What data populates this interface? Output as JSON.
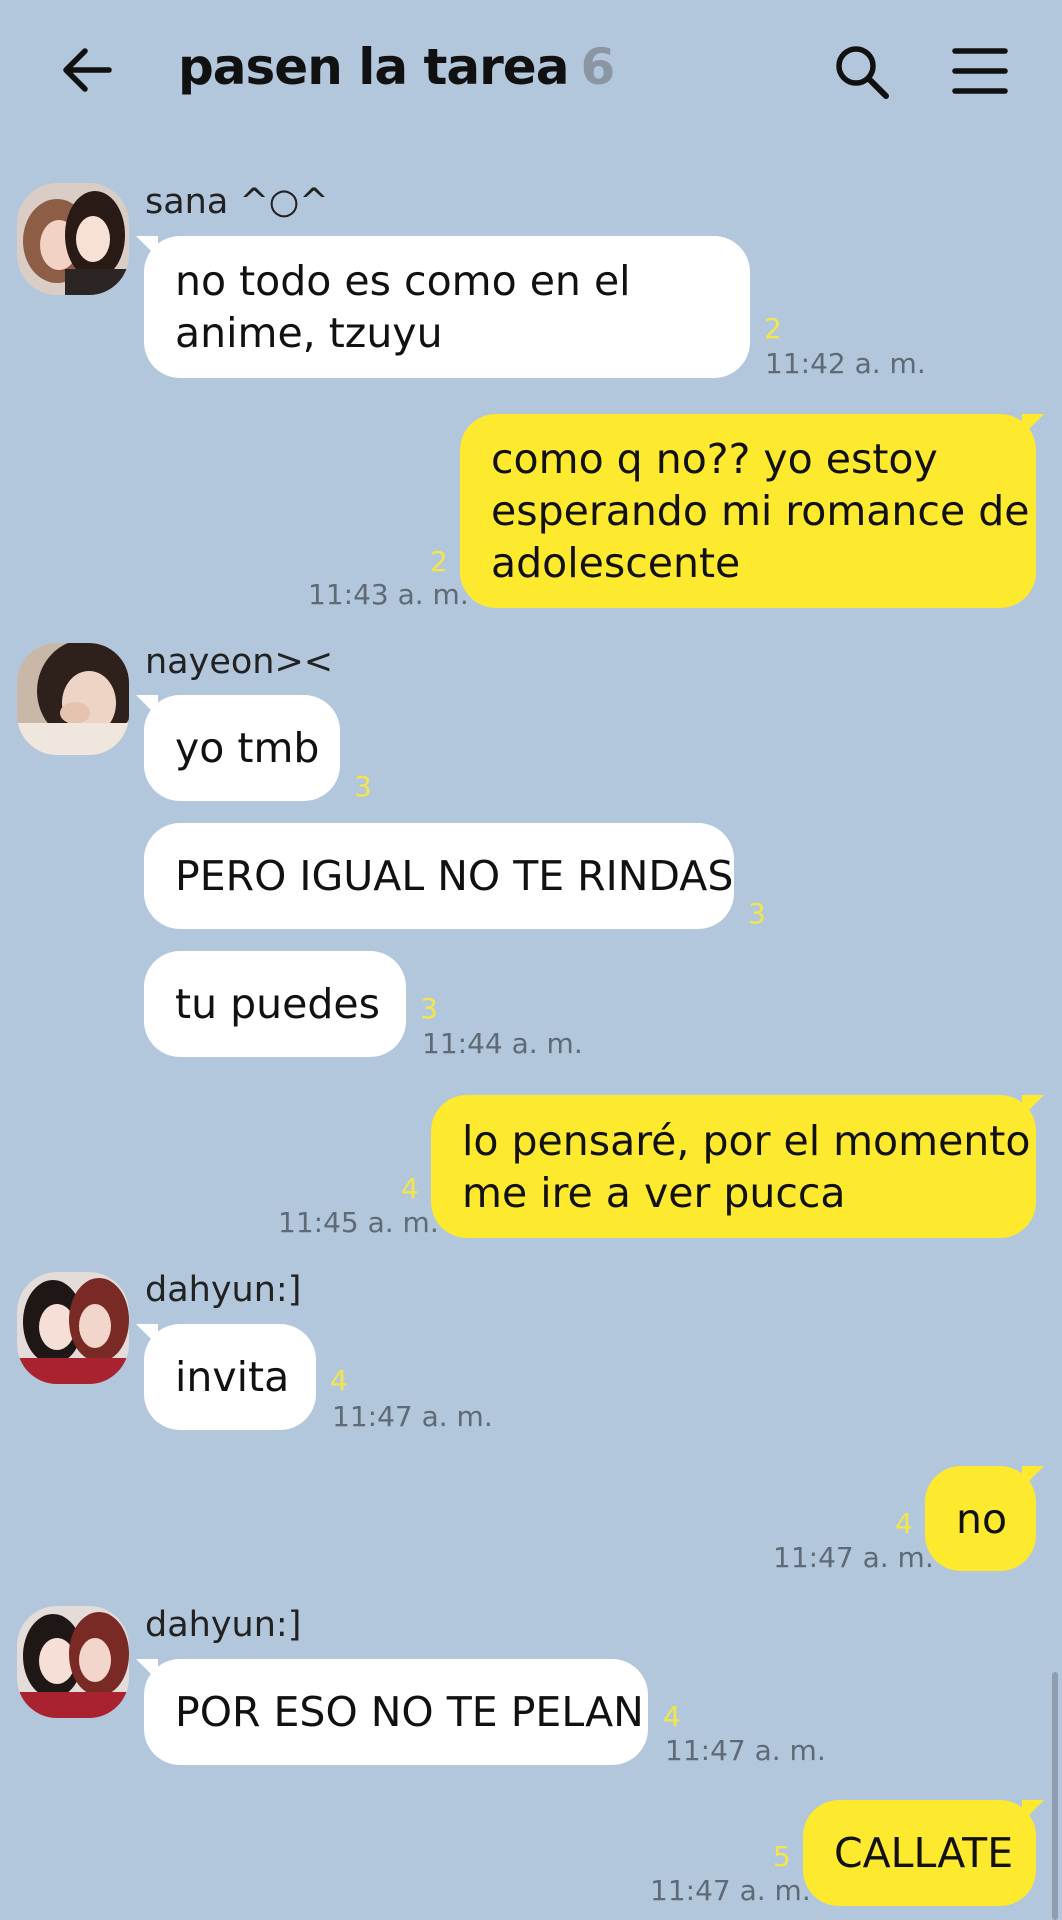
{
  "header": {
    "title": "pasen la tarea",
    "member_count": "6"
  },
  "messages": [
    {
      "sender": "sana ^○^",
      "text_lines": [
        "no todo es como en el",
        "anime, tzuyu"
      ],
      "unread": "2",
      "time": "11:42 a. m."
    },
    {
      "text_lines": [
        "como q no?? yo estoy",
        "esperando mi romance de",
        "adolescente"
      ],
      "unread": "2",
      "time": "11:43 a. m."
    },
    {
      "sender": "nayeon><",
      "text": "yo tmb",
      "unread": "3"
    },
    {
      "text": "PERO IGUAL NO TE RINDAS",
      "unread": "3"
    },
    {
      "text": "tu puedes",
      "unread": "3",
      "time": "11:44 a. m."
    },
    {
      "text_lines": [
        "lo pensaré, por el momento",
        "me ire a ver pucca"
      ],
      "unread": "4",
      "time": "11:45 a. m."
    },
    {
      "sender": "dahyun:]",
      "text": "invita",
      "unread": "4",
      "time": "11:47 a. m."
    },
    {
      "text": "no",
      "unread": "4",
      "time": "11:47 a. m."
    },
    {
      "sender": "dahyun:]",
      "text": "POR ESO NO TE PELAN",
      "unread": "4",
      "time": "11:47 a. m."
    },
    {
      "text": "CALLATE",
      "unread": "5",
      "time": "11:47 a. m."
    }
  ],
  "colors": {
    "background": "#b3c7dc",
    "incoming_bubble": "#ffffff",
    "outgoing_bubble": "#fde92e",
    "unread_count": "#f4e64a",
    "timestamp": "#5e6a76"
  }
}
